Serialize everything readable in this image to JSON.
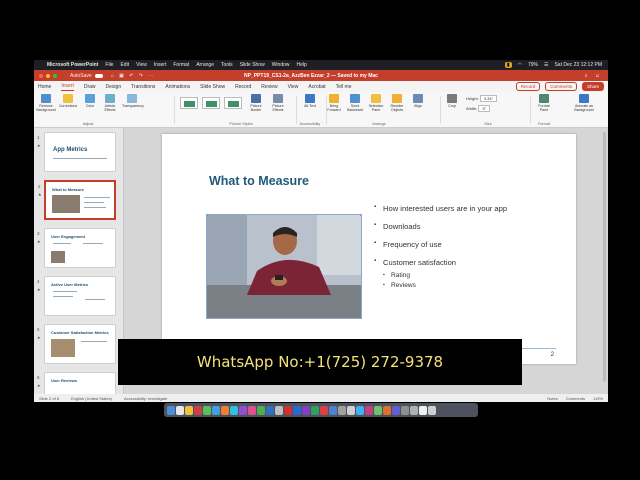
{
  "menubar": {
    "app_name": "Microsoft PowerPoint",
    "items": [
      "File",
      "Edit",
      "View",
      "Insert",
      "Format",
      "Arrange",
      "Tools",
      "Slide Show",
      "Window",
      "Help"
    ],
    "battery": "79%",
    "datetime": "Sat Dec 23  12:12 PM"
  },
  "titlebar": {
    "autosave_label": "AutoSave",
    "autosave_state": "OFF",
    "document_title": "NP_PPT19_CS1-2a_AzzBen Ezzar_2  —  Saved to my Mac"
  },
  "tabs": [
    "Home",
    "Insert",
    "Draw",
    "Design",
    "Transitions",
    "Animations",
    "Slide Show",
    "Record",
    "Review",
    "View",
    "Acrobat",
    "Tell me"
  ],
  "active_tab": "Insert",
  "tab_actions": {
    "record": "Record",
    "comments": "Comments",
    "share": "Share"
  },
  "ribbon": {
    "adjust": [
      "Remove Background",
      "Corrections",
      "Color",
      "Artistic Effects",
      "Transparency"
    ],
    "adjust_label": "Adjust",
    "picture_styles_label": "Picture Styles",
    "picture_border": "Picture Border",
    "picture_effects": "Picture Effects",
    "accessibility": [
      "Alt Text"
    ],
    "accessibility_label": "Accessibility",
    "arrange": [
      "Bring Forward",
      "Send Backward",
      "Selection Pane",
      "Reorder Objects",
      "Align"
    ],
    "arrange_label": "Arrange",
    "crop": "Crop",
    "height_label": "Height:",
    "height_value": "3.34\"",
    "width_label": "Width:",
    "width_value": "5\"",
    "size_label": "Size",
    "format_pane": "Format Pane",
    "format_label": "Format",
    "animate_bg": "Animate as Background"
  },
  "thumbnails": [
    {
      "num": "1",
      "title": "App Metrics"
    },
    {
      "num": "2",
      "title": "What to Measure"
    },
    {
      "num": "3",
      "title": "User Engagement"
    },
    {
      "num": "4",
      "title": "Active User Metrics"
    },
    {
      "num": "5",
      "title": "Customer Satisfaction Metrics"
    },
    {
      "num": "6",
      "title": "User Reviews"
    }
  ],
  "slide": {
    "title": "What to Measure",
    "bullets": [
      "How interested users are in your app",
      "Downloads",
      "Frequency of use",
      "Customer satisfaction"
    ],
    "sub_bullets": [
      "Rating",
      "Reviews"
    ],
    "page_number": "2"
  },
  "statusbar": {
    "slide_info": "Slide 2 of 8",
    "language": "English (United States)",
    "accessibility": "Accessibility: Investigate",
    "notes": "Notes",
    "comments": "Comments",
    "zoom": "119%"
  },
  "watermark": "WhatsApp No:+1(725) 272-9378",
  "dock_colors": [
    "#4a90d9",
    "#e8e8e8",
    "#f0c040",
    "#d04040",
    "#5ac05a",
    "#40a0e0",
    "#f08030",
    "#30c0e0",
    "#9050d0",
    "#e05090",
    "#50b050",
    "#3070c0",
    "#c0c0c0",
    "#d03030",
    "#2a6ad0",
    "#8040c0",
    "#30a060",
    "#e04040",
    "#5080d0",
    "#a0a0a0",
    "#d0d0d0",
    "#40b0f0",
    "#c04080",
    "#70c070",
    "#e07030",
    "#6060d0",
    "#909090",
    "#b0b0b0",
    "#f0f0f0",
    "#d0d0d0"
  ]
}
